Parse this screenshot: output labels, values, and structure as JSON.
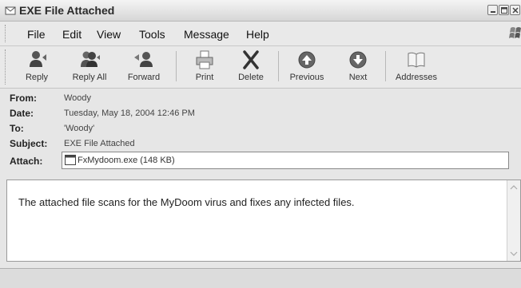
{
  "window": {
    "title": "EXE File Attached"
  },
  "menu": [
    "File",
    "Edit",
    "View",
    "Tools",
    "Message",
    "Help"
  ],
  "toolbar": {
    "buttons": [
      {
        "label": "Reply",
        "icon": "reply-icon"
      },
      {
        "label": "Reply All",
        "icon": "reply-all-icon"
      },
      {
        "label": "Forward",
        "icon": "forward-icon"
      },
      {
        "label": "Print",
        "icon": "print-icon"
      },
      {
        "label": "Delete",
        "icon": "delete-icon"
      },
      {
        "label": "Previous",
        "icon": "previous-icon"
      },
      {
        "label": "Next",
        "icon": "next-icon"
      },
      {
        "label": "Addresses",
        "icon": "addresses-icon"
      }
    ]
  },
  "header": {
    "from_label": "From:",
    "from": "Woody",
    "date_label": "Date:",
    "date": "Tuesday, May 18, 2004 12:46 PM",
    "to_label": "To:",
    "to": "'Woody'",
    "subject_label": "Subject:",
    "subject": "EXE File Attached",
    "attach_label": "Attach:",
    "attachment": "FxMydoom.exe (148 KB)"
  },
  "message": {
    "body": "The attached file scans for the MyDoom virus and fixes any infected files."
  }
}
